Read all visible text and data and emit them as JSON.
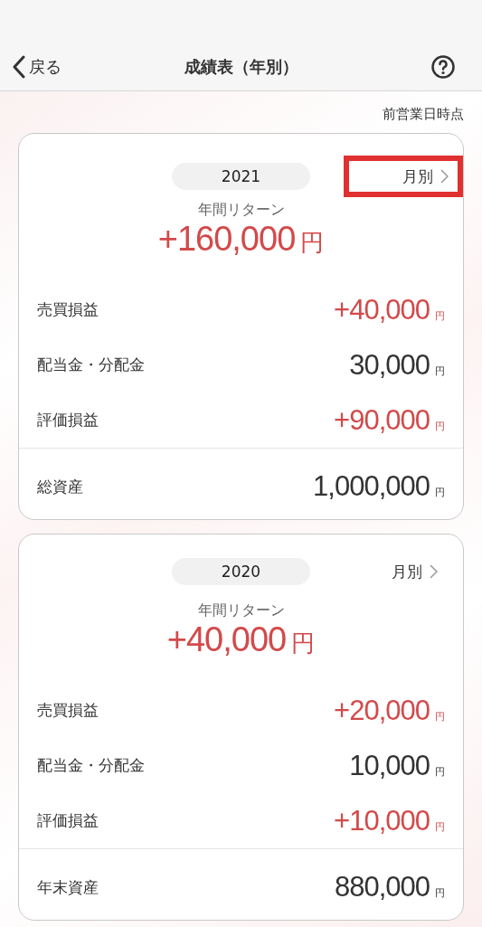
{
  "header": {
    "back_label": "戻る",
    "title": "成績表（年別）"
  },
  "as_of": "前営業日時点",
  "cards": [
    {
      "year": "2021",
      "monthly_link": {
        "label": "月別",
        "highlighted": true
      },
      "return_label": "年間リターン",
      "return_value": "+160,000",
      "return_unit": "円",
      "rows": [
        {
          "label": "売買損益",
          "value": "+40,000",
          "unit": "円",
          "kind": "gain"
        },
        {
          "label": "配当金・分配金",
          "value": "30,000",
          "unit": "円",
          "kind": "neutral"
        },
        {
          "label": "評価損益",
          "value": "+90,000",
          "unit": "円",
          "kind": "gain"
        }
      ],
      "total": {
        "label": "総資産",
        "value": "1,000,000",
        "unit": "円"
      }
    },
    {
      "year": "2020",
      "monthly_link": {
        "label": "月別",
        "highlighted": false
      },
      "return_label": "年間リターン",
      "return_value": "+40,000",
      "return_unit": "円",
      "rows": [
        {
          "label": "売買損益",
          "value": "+20,000",
          "unit": "円",
          "kind": "gain"
        },
        {
          "label": "配当金・分配金",
          "value": "10,000",
          "unit": "円",
          "kind": "neutral"
        },
        {
          "label": "評価損益",
          "value": "+10,000",
          "unit": "円",
          "kind": "gain"
        }
      ],
      "total": {
        "label": "年末資産",
        "value": "880,000",
        "unit": "円"
      }
    }
  ]
}
